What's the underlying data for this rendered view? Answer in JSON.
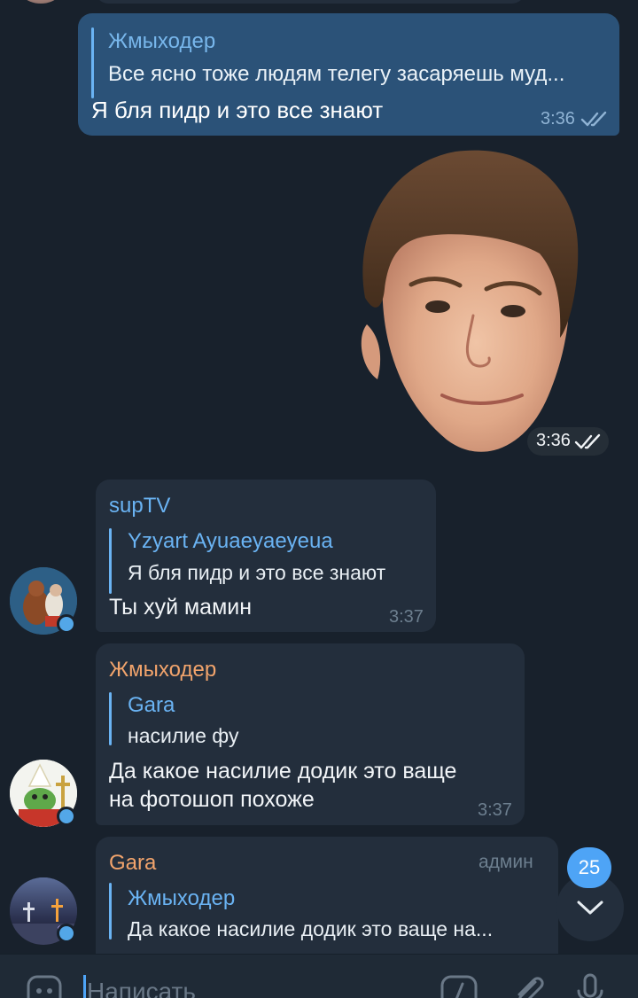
{
  "out_message": {
    "reply_name": "Жмыходер",
    "reply_text": "Все ясно тоже людям телегу засаряешь муд...",
    "text": "Я бля пидр и это все знают",
    "time": "3:36"
  },
  "sticker": {
    "time": "3:36"
  },
  "messages": [
    {
      "sender": "supTV",
      "reply_name": "Yzyart Ayuaeyaeyeua",
      "reply_text": "Я бля пидр и это все знают",
      "text": "Ты хуй мамин",
      "time": "3:37"
    },
    {
      "sender": "Жмыходер",
      "reply_name": "Gara",
      "reply_text": "насилие фу",
      "text_line1": "Да какое насилие додик это ваще",
      "text_line2": "на фотошоп похоже",
      "time": "3:37"
    },
    {
      "sender": "Gara",
      "badge": "админ",
      "reply_name": "Жмыходер",
      "reply_text": "Да какое насилие додик это ваще на..."
    }
  ],
  "unread_count": "25",
  "input": {
    "placeholder": "Написать"
  },
  "colors": {
    "accent": "#4ea4f6",
    "outgoing": "#2b5278",
    "incoming": "#232e3c",
    "background": "#18212c"
  },
  "icons": [
    "double-check-icon",
    "chevron-down-icon",
    "emoji-icon",
    "command-icon",
    "attach-icon",
    "microphone-icon"
  ]
}
